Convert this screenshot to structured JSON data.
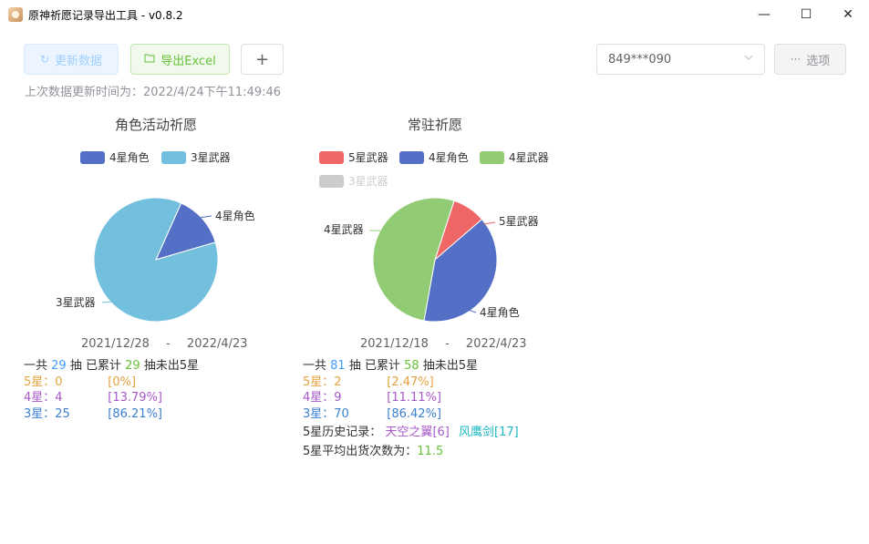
{
  "window": {
    "title": "原神祈愿记录导出工具 - v0.8.2",
    "minimize": "—",
    "maximize": "☐",
    "close": "✕"
  },
  "toolbar": {
    "refresh_label": "更新数据",
    "export_label": "导出Excel",
    "add_label": "+",
    "uid_selected": "849***090",
    "options_label": "选项"
  },
  "last_update": "上次数据更新时间为：2022/4/24下午11:49:46",
  "colors": {
    "five_star_weapon": "#ee6666",
    "four_star_char": "#5470c6",
    "four_star_weapon": "#91cc75",
    "three_star_weapon": "#73c0de",
    "disabled": "#cccccc"
  },
  "pools": [
    {
      "title": "角色活动祈愿",
      "date_start": "2021/12/28",
      "date_sep": "-",
      "date_end": "2022/4/23",
      "summary": {
        "prefix": "一共",
        "total": "29",
        "mid": "抽 已累计",
        "pity": "29",
        "suffix": "抽未出5星"
      },
      "star5": {
        "label": "5星：",
        "count": "0",
        "pct": "[0%]"
      },
      "star4": {
        "label": "4星：",
        "count": "4",
        "pct": "[13.79%]"
      },
      "star3": {
        "label": "3星：",
        "count": "25",
        "pct": "[86.21%]"
      }
    },
    {
      "title": "常驻祈愿",
      "date_start": "2021/12/18",
      "date_sep": "-",
      "date_end": "2022/4/23",
      "summary": {
        "prefix": "一共",
        "total": "81",
        "mid": "抽 已累计",
        "pity": "58",
        "suffix": "抽未出5星"
      },
      "star5": {
        "label": "5星：",
        "count": "2",
        "pct": "[2.47%]"
      },
      "star4": {
        "label": "4星：",
        "count": "9",
        "pct": "[11.11%]"
      },
      "star3": {
        "label": "3星：",
        "count": "70",
        "pct": "[86.42%]"
      },
      "history_label": "5星历史记录：",
      "history": [
        {
          "name": "天空之翼",
          "count": "[6]"
        },
        {
          "name": "风鹰剑",
          "count": "[17]"
        }
      ],
      "avg_label": "5星平均出货次数为：",
      "avg_value": "11.5"
    }
  ],
  "chart_data": [
    {
      "type": "pie",
      "title": "角色活动祈愿",
      "legend": [
        "4星角色",
        "3星武器"
      ],
      "slices": [
        {
          "name": "4星角色",
          "value": 4,
          "color": "#5470c6"
        },
        {
          "name": "3星武器",
          "value": 25,
          "color": "#73c0de"
        }
      ]
    },
    {
      "type": "pie",
      "title": "常驻祈愿",
      "legend": [
        "5星武器",
        "4星角色",
        "4星武器",
        "3星武器"
      ],
      "legend_disabled": [
        "3星武器"
      ],
      "slices": [
        {
          "name": "5星武器",
          "value": 2,
          "color": "#ee6666"
        },
        {
          "name": "4星角色",
          "value": 9,
          "color": "#5470c6"
        },
        {
          "name": "4星武器",
          "value": 12,
          "color": "#91cc75"
        }
      ]
    }
  ]
}
